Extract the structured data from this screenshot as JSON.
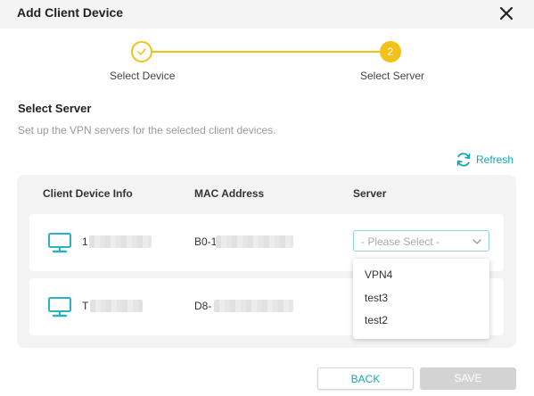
{
  "dialog": {
    "title": "Add Client Device"
  },
  "stepper": {
    "steps": [
      {
        "label": "Select Device",
        "state": "completed"
      },
      {
        "label": "Select Server",
        "state": "current",
        "number": "2"
      }
    ],
    "accent_color": "#f2c21a"
  },
  "section": {
    "title": "Select Server",
    "description": "Set up the VPN servers for the selected client devices."
  },
  "refresh": {
    "label": "Refresh",
    "icon": "refresh-icon"
  },
  "table": {
    "columns": [
      "Client Device Info",
      "MAC Address",
      "Server"
    ],
    "rows": [
      {
        "device": "1",
        "mac": "B0-1",
        "server_placeholder": "- Please Select -"
      },
      {
        "device": "T",
        "mac": "D8-"
      }
    ]
  },
  "dropdown": {
    "options": [
      "VPN4",
      "test3",
      "test2"
    ]
  },
  "buttons": {
    "back": "BACK",
    "save": "SAVE"
  },
  "colors": {
    "accent": "#17a6b5",
    "step": "#f2c21a",
    "disabled": "#d3d3d3"
  }
}
